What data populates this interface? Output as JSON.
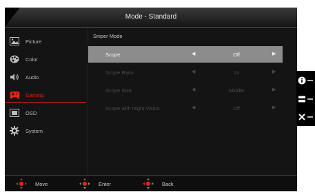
{
  "header": {
    "title": "Mode - Standard"
  },
  "sidebar": {
    "items": [
      {
        "label": "Picture",
        "icon": "picture-icon"
      },
      {
        "label": "Color",
        "icon": "palette-icon"
      },
      {
        "label": "Audio",
        "icon": "speaker-icon"
      },
      {
        "label": "Gaming",
        "icon": "gamepad-icon"
      },
      {
        "label": "OSD",
        "icon": "osd-icon"
      },
      {
        "label": "System",
        "icon": "gear-icon"
      }
    ],
    "active": "Gaming"
  },
  "section": {
    "title": "Sniper Mode"
  },
  "settings": [
    {
      "label": "Scope",
      "value": "Off"
    },
    {
      "label": "Scope Ratio",
      "value": "2x"
    },
    {
      "label": "Scope Size",
      "value": "Middle"
    },
    {
      "label": "Scope with Night Vision",
      "value": "Off"
    }
  ],
  "footer": {
    "move": "Move",
    "enter": "Enter",
    "back": "Back"
  },
  "side_keys": [
    "info-icon",
    "menu-icon",
    "close-icon"
  ],
  "colors": {
    "accent": "#e1251b",
    "selected_row": "#8c8c8c",
    "background": "#141414"
  }
}
